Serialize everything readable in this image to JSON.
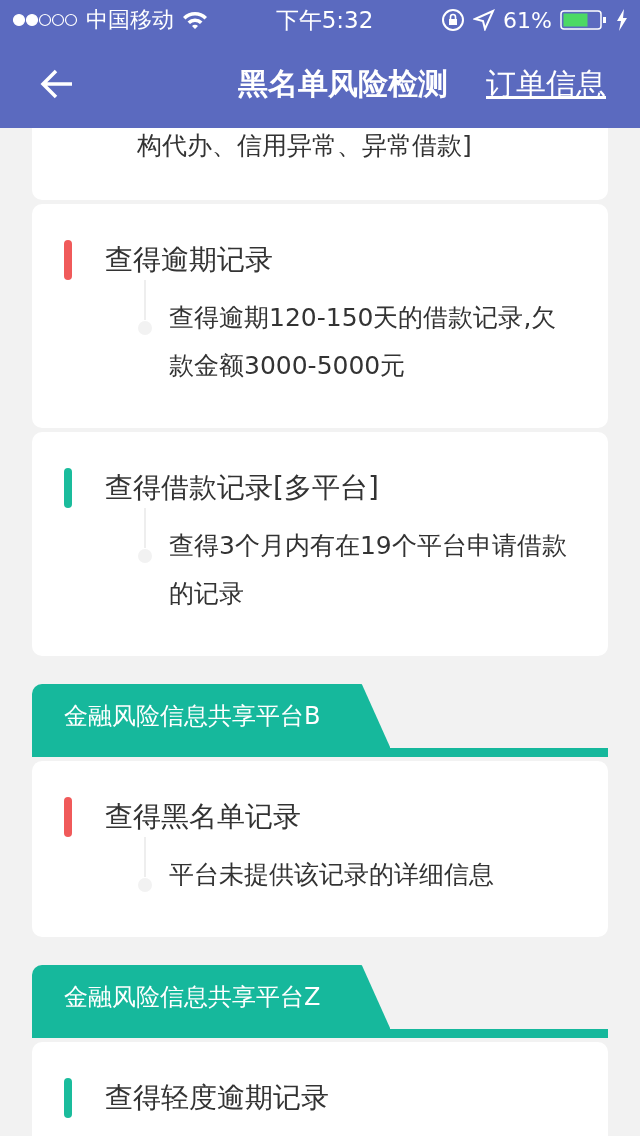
{
  "status_bar": {
    "carrier": "中国移动",
    "time": "下午5:32",
    "battery": "61%"
  },
  "nav": {
    "title": "黑名单风险检测",
    "link": "订单信息"
  },
  "sections": [
    {
      "records": [
        {
          "detail": "构代办、信用异常、异常借款]"
        },
        {
          "title": "查得逾期记录",
          "color": "#f05a5a",
          "detail": "查得逾期120-150天的借款记录,欠款金额3000-5000元"
        },
        {
          "title": "查得借款记录[多平台]",
          "color": "#1abc9c",
          "detail": "查得3个月内有在19个平台申请借款的记录"
        }
      ]
    },
    {
      "header": "金融风险信息共享平台B",
      "records": [
        {
          "title": "查得黑名单记录",
          "color": "#f05a5a",
          "detail": "平台未提供该记录的详细信息"
        }
      ]
    },
    {
      "header": "金融风险信息共享平台Z",
      "records": [
        {
          "title": "查得轻度逾期记录",
          "color": "#1abc9c"
        }
      ]
    }
  ]
}
